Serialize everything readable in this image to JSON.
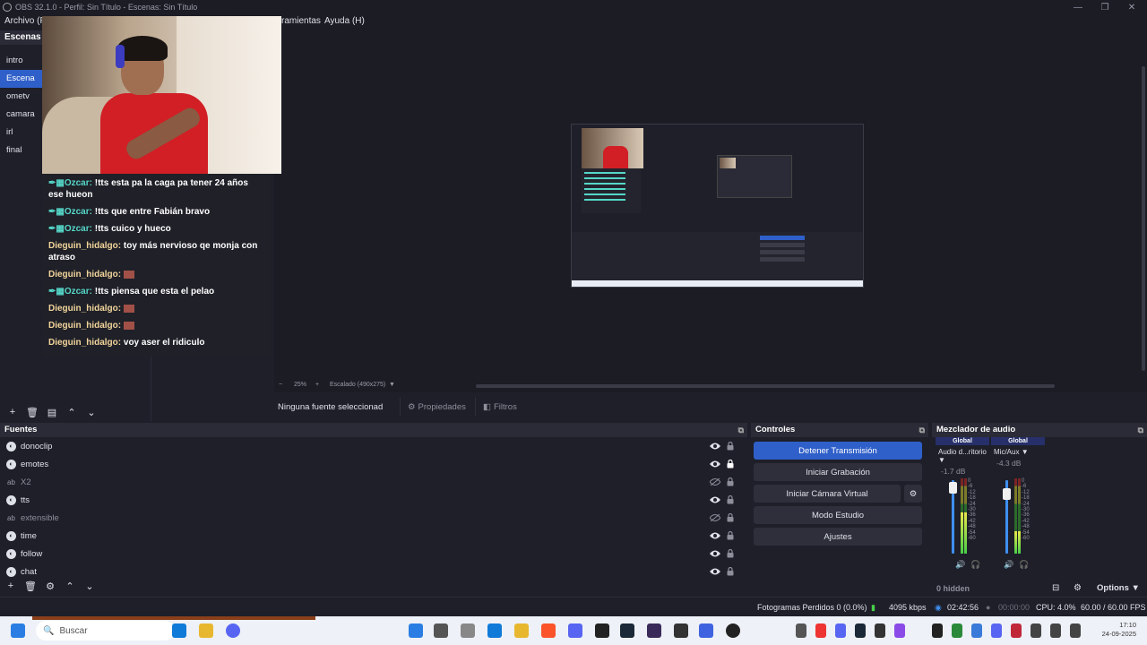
{
  "window": {
    "title": "OBS 32.1.0 - Perfil: Sin Título - Escenas: Sin Título"
  },
  "menu": {
    "items": [
      "Archivo (F)",
      "ramientas",
      "Ayuda (H)"
    ]
  },
  "scenes": {
    "header": "Escenas",
    "items": [
      "intro",
      "Escena",
      "ometv",
      "camara",
      "irl",
      "final"
    ],
    "active": "Escena"
  },
  "chat": {
    "messages": [
      {
        "user": "Ozcar:",
        "text": "!tts esta pa la caga pa tener 24 años ese hueon",
        "kind": "ozcar"
      },
      {
        "user": "Ozcar:",
        "text": "!tts que entre Fabián bravo",
        "kind": "ozcar"
      },
      {
        "user": "Ozcar:",
        "text": "!tts cuico y hueco",
        "kind": "ozcar"
      },
      {
        "user": "Dieguin_hidalgo:",
        "text": "toy más nervioso qe monja con atraso",
        "kind": "dg"
      },
      {
        "user": "Dieguin_hidalgo:",
        "text": "",
        "kind": "dg-emote"
      },
      {
        "user": "Ozcar:",
        "text": "!tts piensa que esta el pelao",
        "kind": "ozcar"
      },
      {
        "user": "Dieguin_hidalgo:",
        "text": "",
        "kind": "dg-emote"
      },
      {
        "user": "Dieguin_hidalgo:",
        "text": "",
        "kind": "dg-emote"
      },
      {
        "user": "Dieguin_hidalgo:",
        "text": "voy aser el ridiculo",
        "kind": "dg"
      }
    ]
  },
  "preview": {
    "zoom": "25%",
    "scaled": "Escalado (490x275)",
    "no_source": "Ninguna fuente seleccionad",
    "properties": "Propiedades",
    "filters": "Filtros"
  },
  "sources": {
    "header": "Fuentes",
    "items": [
      {
        "name": "donoclip",
        "icon": "browser",
        "visible": true,
        "locked": false
      },
      {
        "name": "emotes",
        "icon": "browser",
        "visible": true,
        "locked": true
      },
      {
        "name": "X2",
        "icon": "text",
        "visible": false,
        "locked": false
      },
      {
        "name": "tts",
        "icon": "browser",
        "visible": true,
        "locked": false
      },
      {
        "name": "extensible",
        "icon": "text",
        "visible": false,
        "locked": false
      },
      {
        "name": "time",
        "icon": "browser",
        "visible": true,
        "locked": false
      },
      {
        "name": "follow",
        "icon": "browser",
        "visible": true,
        "locked": false
      },
      {
        "name": "chat",
        "icon": "browser",
        "visible": true,
        "locked": false
      }
    ]
  },
  "controls": {
    "header": "Controles",
    "stop_stream": "Detener Transmisión",
    "start_recording": "Iniciar Grabación",
    "start_virtual_cam": "Iniciar Cámara Virtual",
    "studio_mode": "Modo Estudio",
    "settings": "Ajustes"
  },
  "mixer": {
    "header": "Mezclador de audio",
    "channels": [
      {
        "global": "Global",
        "name": "Audio d...ritorio",
        "db": "-1.7 dB",
        "fader": 0.9,
        "level": 0.55
      },
      {
        "global": "Global",
        "name": "Mic/Aux",
        "db": "-4.3 dB",
        "fader": 0.82,
        "level": 0.3
      }
    ],
    "ticks": [
      "0",
      "-6",
      "-12",
      "-18",
      "-24",
      "-30",
      "-36",
      "-42",
      "-48",
      "-54",
      "-60"
    ],
    "hidden": "0 hidden",
    "options": "Options"
  },
  "status": {
    "dropped": "Fotogramas Perdidos 0 (0.0%)",
    "bitrate": "4095 kbps",
    "stream_time": "02:42:56",
    "rec_time": "00:00:00",
    "cpu": "CPU: 4.0%",
    "fps": "60.00 / 60.00 FPS"
  },
  "taskbar": {
    "search": "Buscar",
    "time": "17:10",
    "date": "24-09-2025"
  }
}
